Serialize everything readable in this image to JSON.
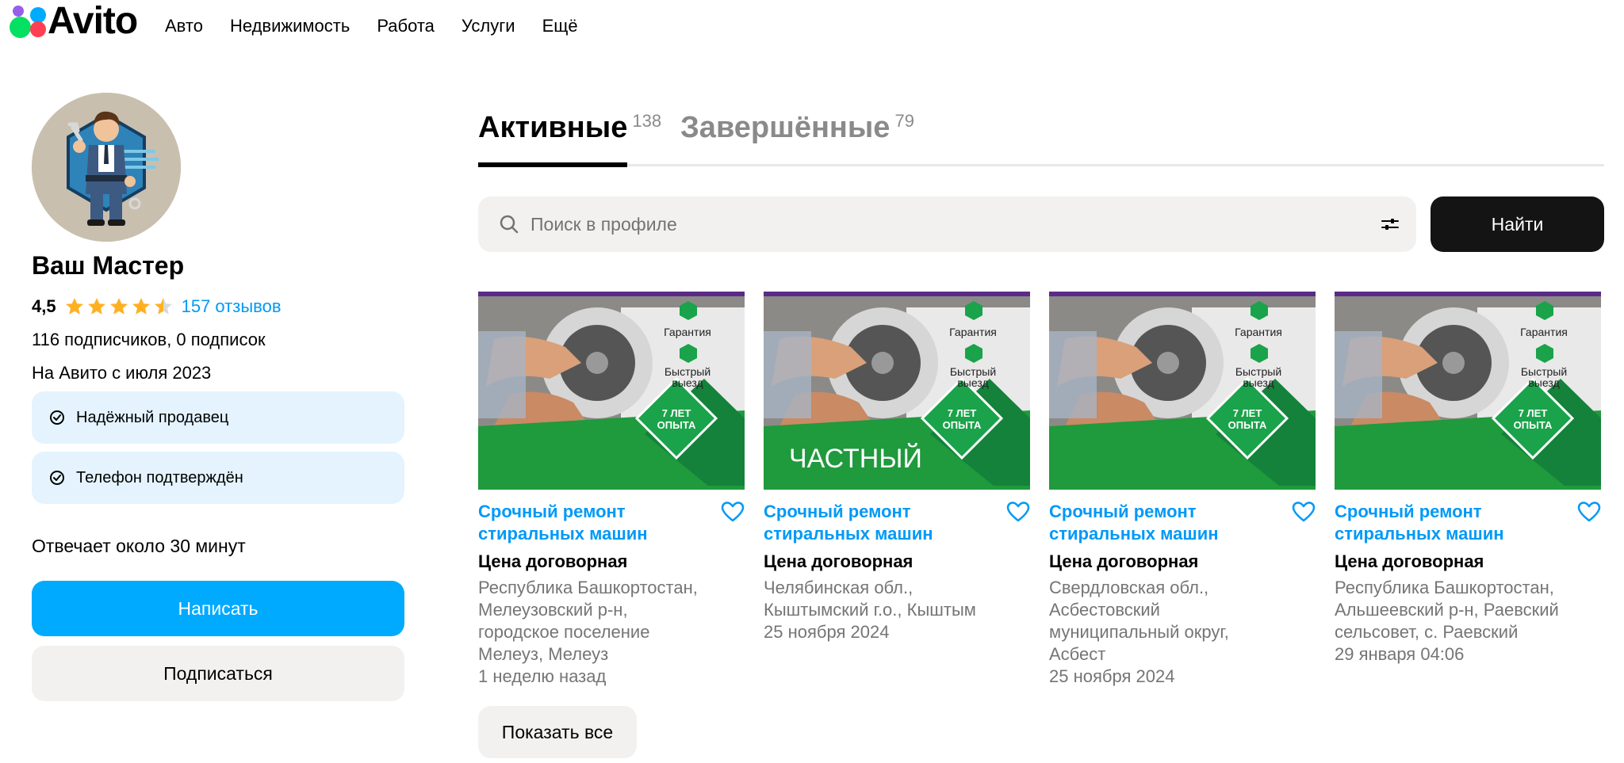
{
  "header": {
    "logo_text": "Avito",
    "nav": [
      "Авто",
      "Недвижимость",
      "Работа",
      "Услуги",
      "Ещё"
    ]
  },
  "seller": {
    "name": "Ваш Мастер",
    "rating": "4,5",
    "stars_value": 4.5,
    "reviews": "157 отзывов",
    "subscribers": "116 подписчиков, 0 подписок",
    "since": "На Авито с июля 2023",
    "badges": [
      "Надёжный продавец",
      "Телефон подтверждён"
    ],
    "response_time": "Отвечает около 30 минут",
    "write_label": "Написать",
    "subscribe_label": "Подписаться"
  },
  "tabs": [
    {
      "label": "Активные",
      "count": "138",
      "active": true
    },
    {
      "label": "Завершённые",
      "count": "79",
      "active": false
    }
  ],
  "search": {
    "placeholder": "Поиск в профиле",
    "value": "",
    "button_label": "Найти"
  },
  "listing_image_text": {
    "guarantee": "Гарантия",
    "fast_1": "Быстрый",
    "fast_2": "выезд",
    "years_1": "7 ЛЕТ",
    "years_2": "ОПЫТА",
    "private": "ЧАСТНЫЙ"
  },
  "listings": [
    {
      "title": "Срочный ремонт стиральных машин",
      "price": "Цена договорная",
      "address": [
        "Республика Башкортостан,",
        "Мелеузовский р-н,",
        "городское поселение",
        "Мелеуз, Мелеуз"
      ],
      "date": "1 неделю назад"
    },
    {
      "title": "Срочный ремонт стиральных машин",
      "price": "Цена договорная",
      "address": [
        "Челябинская обл.,",
        "Кыштымский г.о., Кыштым"
      ],
      "date": "25 ноября 2024"
    },
    {
      "title": "Срочный ремонт стиральных машин",
      "price": "Цена договорная",
      "address": [
        "Свердловская обл.,",
        "Асбестовский",
        "муниципальный округ,",
        "Асбест"
      ],
      "date": "25 ноября 2024"
    },
    {
      "title": "Срочный ремонт стиральных машин",
      "price": "Цена договорная",
      "address": [
        "Республика Башкортостан,",
        "Альшеевский р-н, Раевский",
        "сельсовет, с. Раевский"
      ],
      "date": "29 января 04:06"
    }
  ],
  "show_all_label": "Показать все",
  "colors": {
    "accent_blue": "#00aaff",
    "link_blue": "#0099f7",
    "star": "#ffb021",
    "badge_bg": "#e4f3fd",
    "dark_button": "#141414",
    "light_button": "#f2f1f0"
  }
}
